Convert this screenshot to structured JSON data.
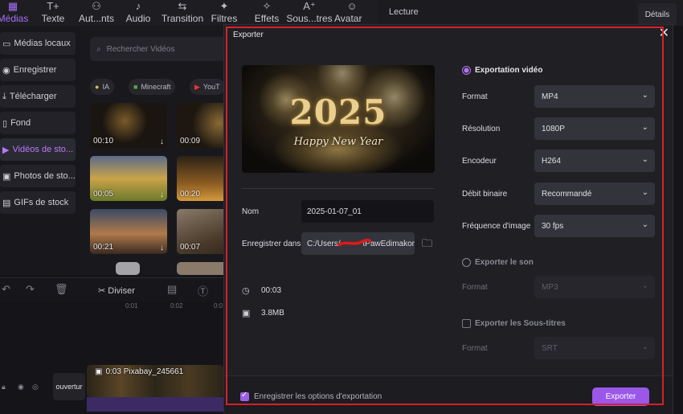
{
  "toolbar": {
    "items": [
      {
        "label": "Médias",
        "icon": "media-icon"
      },
      {
        "label": "Texte",
        "icon": "text-icon"
      },
      {
        "label": "Aut...nts",
        "icon": "elements-icon"
      },
      {
        "label": "Audio",
        "icon": "audio-icon"
      },
      {
        "label": "Transition",
        "icon": "transition-icon"
      },
      {
        "label": "Filtres",
        "icon": "filter-icon"
      },
      {
        "label": "Effets",
        "icon": "effects-icon"
      },
      {
        "label": "Sous...tres",
        "icon": "subtitles-icon"
      },
      {
        "label": "Avatar IA",
        "icon": "avatar-icon"
      }
    ]
  },
  "player": {
    "label": "Lecture",
    "details": "Détails"
  },
  "sidebar": {
    "items": [
      {
        "label": "Médias locaux"
      },
      {
        "label": "Enregistrer"
      },
      {
        "label": "Télécharger"
      },
      {
        "label": "Fond"
      },
      {
        "label": "Vidéos de sto..."
      },
      {
        "label": "Photos de sto..."
      },
      {
        "label": "GIFs de stock"
      }
    ]
  },
  "library": {
    "search_placeholder": "Rechercher Vidéos",
    "chips": [
      "IA",
      "Minecraft",
      "YouT"
    ],
    "thumbs": [
      "00:10",
      "00:09",
      "00:05",
      "00:20",
      "00:21",
      "00:07"
    ]
  },
  "timeline": {
    "split_label": "Diviser",
    "ruler": [
      "0:01",
      "0:02",
      "0:0"
    ],
    "clip_label": "0:03  Pixabay_245661",
    "track_label": "ouvertur"
  },
  "dialog": {
    "title": "Exporter",
    "preview": {
      "year": "2025",
      "caption": "Happy New Year"
    },
    "name_label": "Nom",
    "name_value": "2025-01-07_01",
    "save_label": "Enregistrer dans",
    "save_path_prefix": "C:/Users/",
    "save_path_suffix": "tPawEdimakor",
    "duration": "00:03",
    "size": "3.8MB",
    "video_export_label": "Exportation vidéo",
    "format_label": "Format",
    "format_value": "MP4",
    "resolution_label": "Résolution",
    "resolution_value": "1080P",
    "encoder_label": "Encodeur",
    "encoder_value": "H264",
    "bitrate_label": "Débit binaire",
    "bitrate_value": "Recommandé",
    "framerate_label": "Fréquence d'image",
    "framerate_value": "30  fps",
    "audio_export_label": "Exporter le son",
    "audio_format_label": "Format",
    "audio_format_value": "MP3",
    "subs_export_label": "Exporter les Sous-titres",
    "subs_format_label": "Format",
    "subs_format_value": "SRT",
    "save_options_label": "Enregistrer les options d'exportation",
    "export_button": "Exporter"
  },
  "colors": {
    "accent": "#9b57e8",
    "highlight": "#d8202a"
  }
}
